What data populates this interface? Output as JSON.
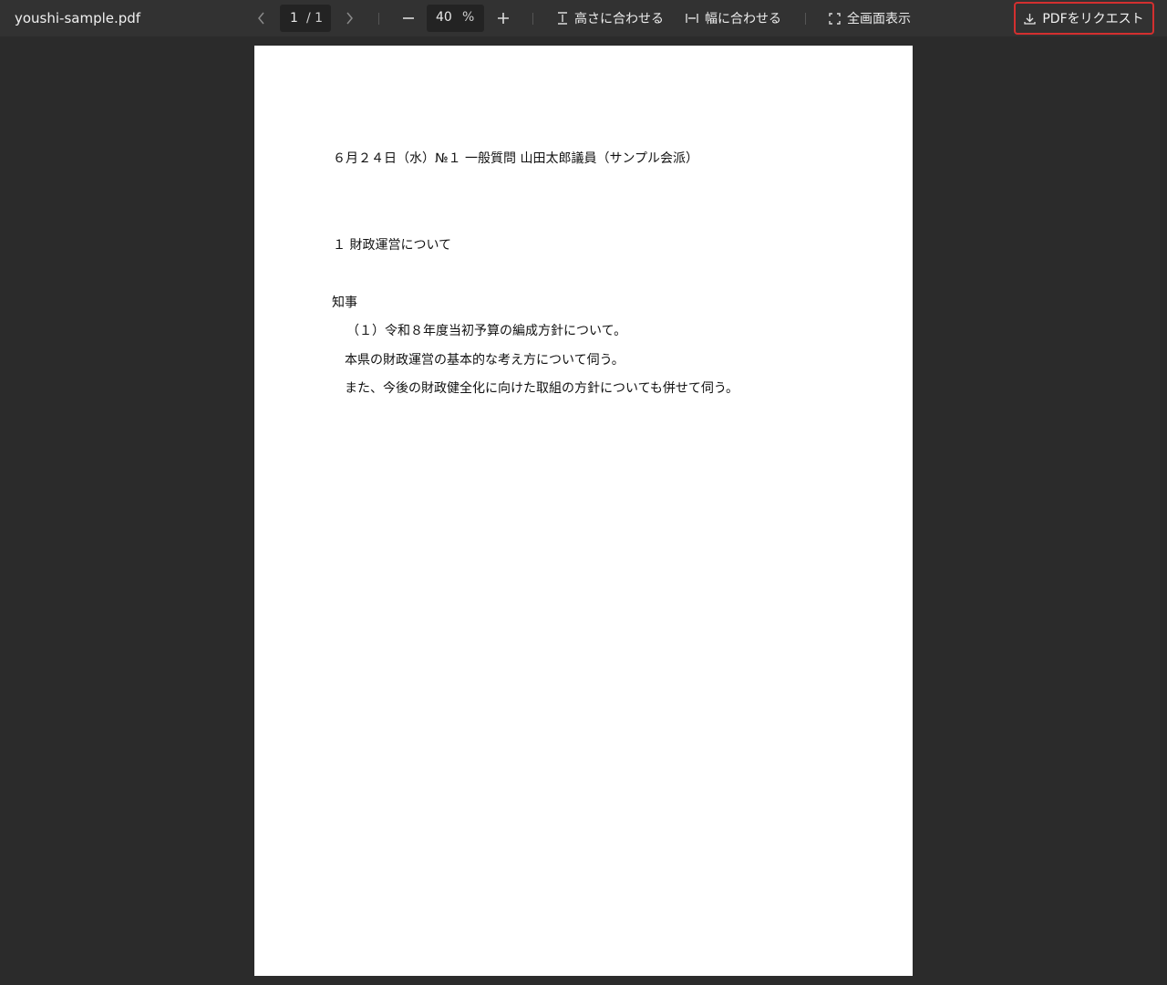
{
  "toolbar": {
    "filename": "youshi-sample.pdf",
    "page_current": "1",
    "page_total": "/ 1",
    "zoom_value": "40",
    "zoom_unit": "%",
    "fit_height_label": "高さに合わせる",
    "fit_width_label": "幅に合わせる",
    "fullscreen_label": "全画面表示",
    "request_pdf_label": "PDFをリクエスト",
    "icons": {
      "prev": "chevron-left-icon",
      "next": "chevron-right-icon",
      "zoom_out": "minus-icon",
      "zoom_in": "plus-icon",
      "fit_height": "fit-height-icon",
      "fit_width": "fit-width-icon",
      "fullscreen": "fullscreen-icon",
      "request": "download-icon"
    },
    "colors": {
      "toolbar_bg": "#323232",
      "request_border": "#d32f2f"
    }
  },
  "document": {
    "header": "６月２４日（水）№１ 一般質問 山田太郎議員（サンプル会派）",
    "section_title": "１ 財政運営について",
    "addressee": "知事",
    "item_title": "（１）令和８年度当初予算の編成方針について。",
    "body_line1": "本県の財政運営の基本的な考え方について伺う。",
    "body_line2": "また、今後の財政健全化に向けた取組の方針についても併せて伺う。"
  }
}
